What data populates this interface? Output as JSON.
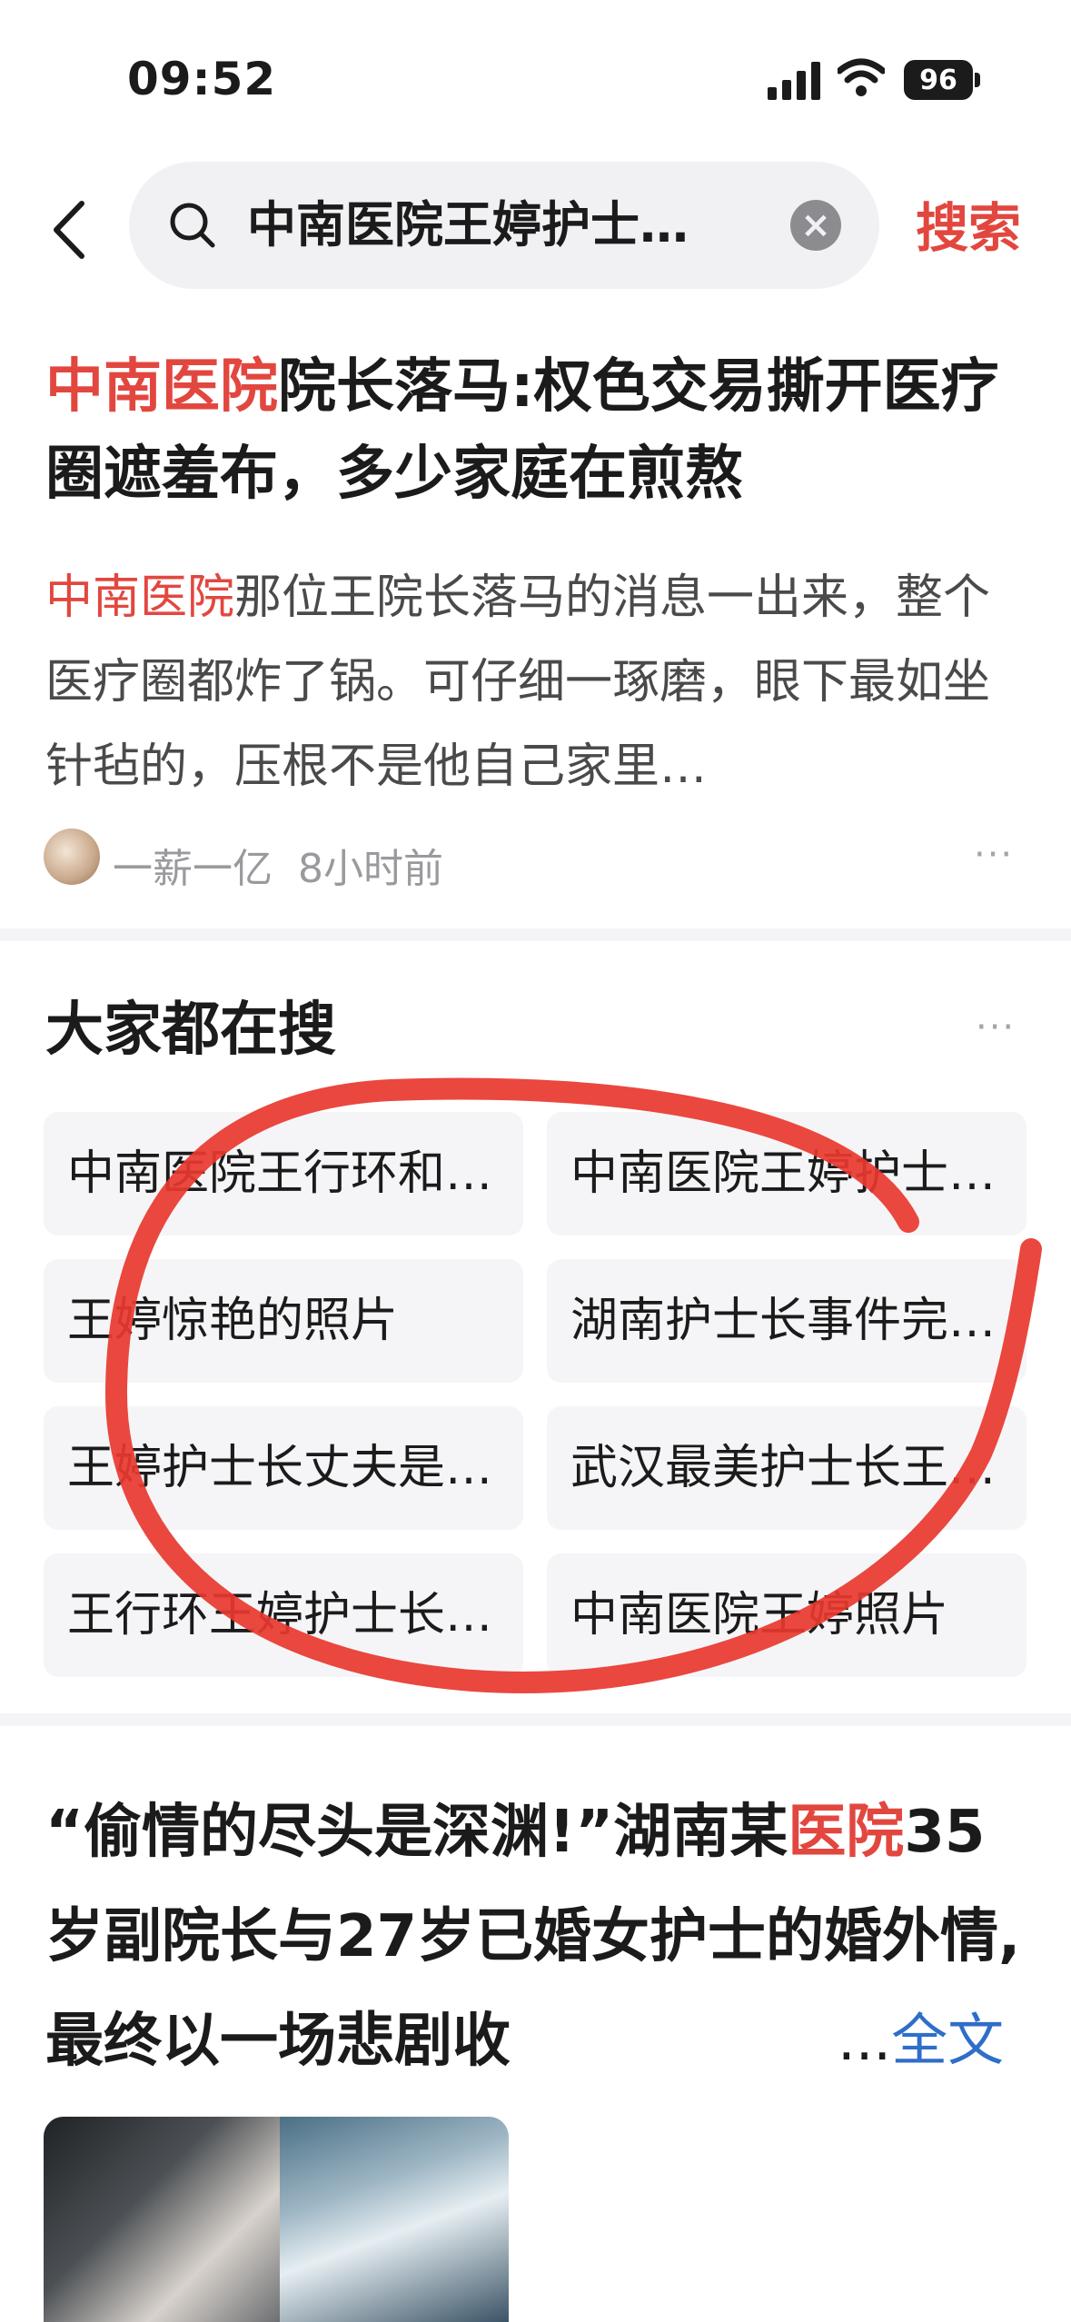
{
  "status_bar": {
    "time": "09:52",
    "battery": "96"
  },
  "search": {
    "query": "中南医院王婷护士…",
    "button": "搜索"
  },
  "article1": {
    "title_highlight": "中南医院",
    "title_rest": "院长落马:权色交易撕开医疗圈遮羞布，多少家庭在煎熬",
    "summary_highlight": "中南医院",
    "summary_rest": "那位王院长落马的消息一出来，整个医疗圈都炸了锅。可仔细一琢磨，眼下最如坐针毡的，压根不是他自己家里…",
    "author": "一薪一亿",
    "time": "8小时前",
    "more": "···"
  },
  "hot_searches": {
    "title": "大家都在搜",
    "more": "···",
    "items": [
      "中南医院王行环和…",
      "中南医院王婷护士…",
      "王婷惊艳的照片",
      "湖南护士长事件完…",
      "王婷护士长丈夫是…",
      "武汉最美护士长王…",
      "王行环王婷护士长…",
      "中南医院王婷照片"
    ]
  },
  "article2": {
    "title_before": "“偷情的尽头是深渊!”湖南某",
    "title_highlight": "医院",
    "title_after": "35岁副院长与27岁已婚女护士的婚外情,最终以一场悲剧收",
    "ellipsis": "...",
    "full_text": "全文"
  },
  "colors": {
    "highlight": "#e2473f",
    "link": "#2f6ec9",
    "annotation": "#e8372f"
  }
}
